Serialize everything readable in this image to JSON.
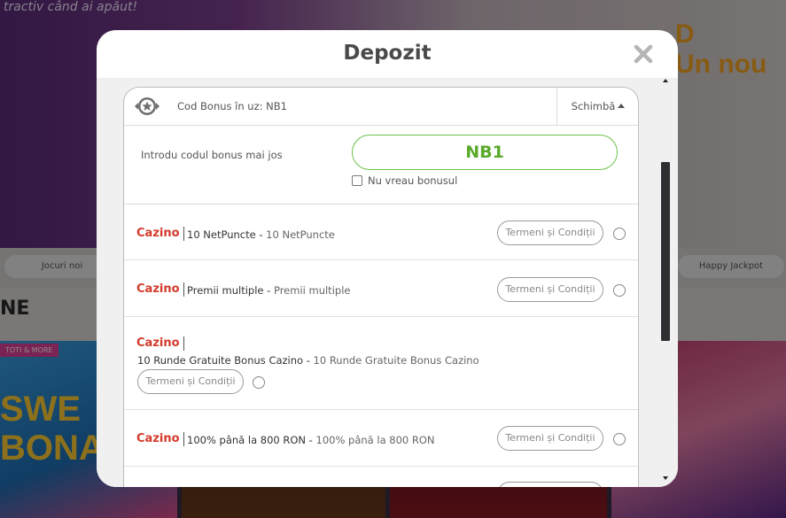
{
  "background": {
    "hero_text": "tractiv când ai apăut!",
    "right_title_line1": "D",
    "right_title_line2": "Un nou",
    "pill_left": "Jocuri noi",
    "pill_right": "Happy Jackpot",
    "section_title": "NE",
    "tile_tag": "TOTI & MORE",
    "tile_text_line1": "SWE",
    "tile_text_line2": "BONAN"
  },
  "modal": {
    "title": "Depozit",
    "bonus_code_label": "Cod Bonus în uz: NB1",
    "change_label": "Schimbă",
    "enter_code_label": "Introdu codul bonus mai jos",
    "code_value": "NB1",
    "no_bonus_label": "Nu vreau bonusul",
    "terms_label": "Termeni și Condiții",
    "offers": [
      {
        "category": "Cazino",
        "title": "10 NetPuncte",
        "subtitle": "10 NetPuncte"
      },
      {
        "category": "Cazino",
        "title": "Premii multiple",
        "subtitle": "Premii multiple"
      },
      {
        "category": "Cazino",
        "title": "10 Runde Gratuite Bonus Cazino",
        "subtitle": "10 Runde Gratuite Bonus Cazino"
      },
      {
        "category": "Cazino",
        "title": "100% până la 800 RON",
        "subtitle": "100% până la 800 RON"
      }
    ]
  },
  "colors": {
    "accent_green": "#6cc24a",
    "category_red": "#d33a2c"
  },
  "icons": {
    "close": "close-icon",
    "badge": "star-badge-icon",
    "caret": "caret-up-icon"
  }
}
